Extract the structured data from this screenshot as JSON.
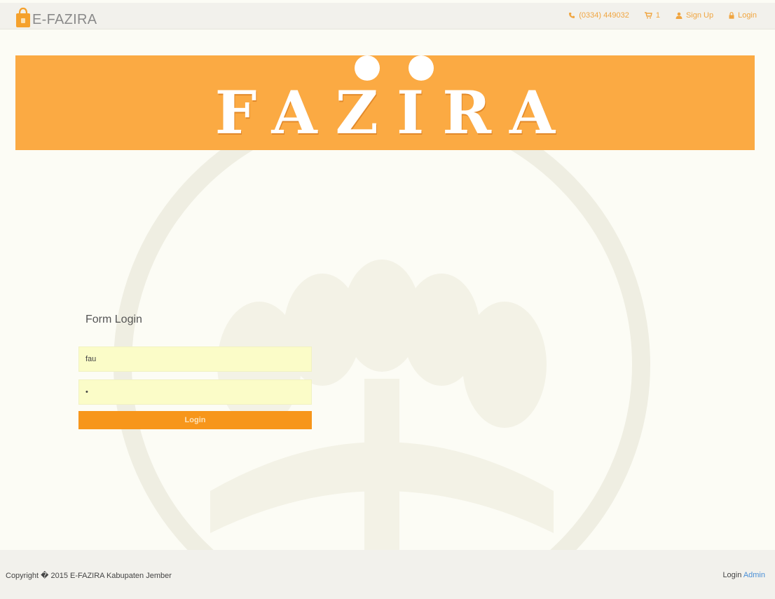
{
  "navbar": {
    "brand": "E-FAZIRA",
    "phone": "(0334) 449032",
    "cart_count": "1",
    "signup": "Sign Up",
    "login": "Login"
  },
  "banner": {
    "title": "FAZIRA"
  },
  "form": {
    "title": "Form Login",
    "username_value": "fau",
    "password_value": "•",
    "submit_label": "Login"
  },
  "footer": {
    "copyright": "Copyright � 2015 E-FAZIRA Kabupaten Jember",
    "login_label": "Login",
    "admin_label": "Admin"
  },
  "colors": {
    "accent": "#f7961b",
    "banner": "#fbaa43",
    "nav_text": "#f0a540",
    "link": "#4a8fd6"
  },
  "icons": {
    "brand": "shopping-bag-icon",
    "phone": "phone-icon",
    "cart": "cart-icon",
    "signup": "user-icon",
    "login": "lock-icon"
  }
}
